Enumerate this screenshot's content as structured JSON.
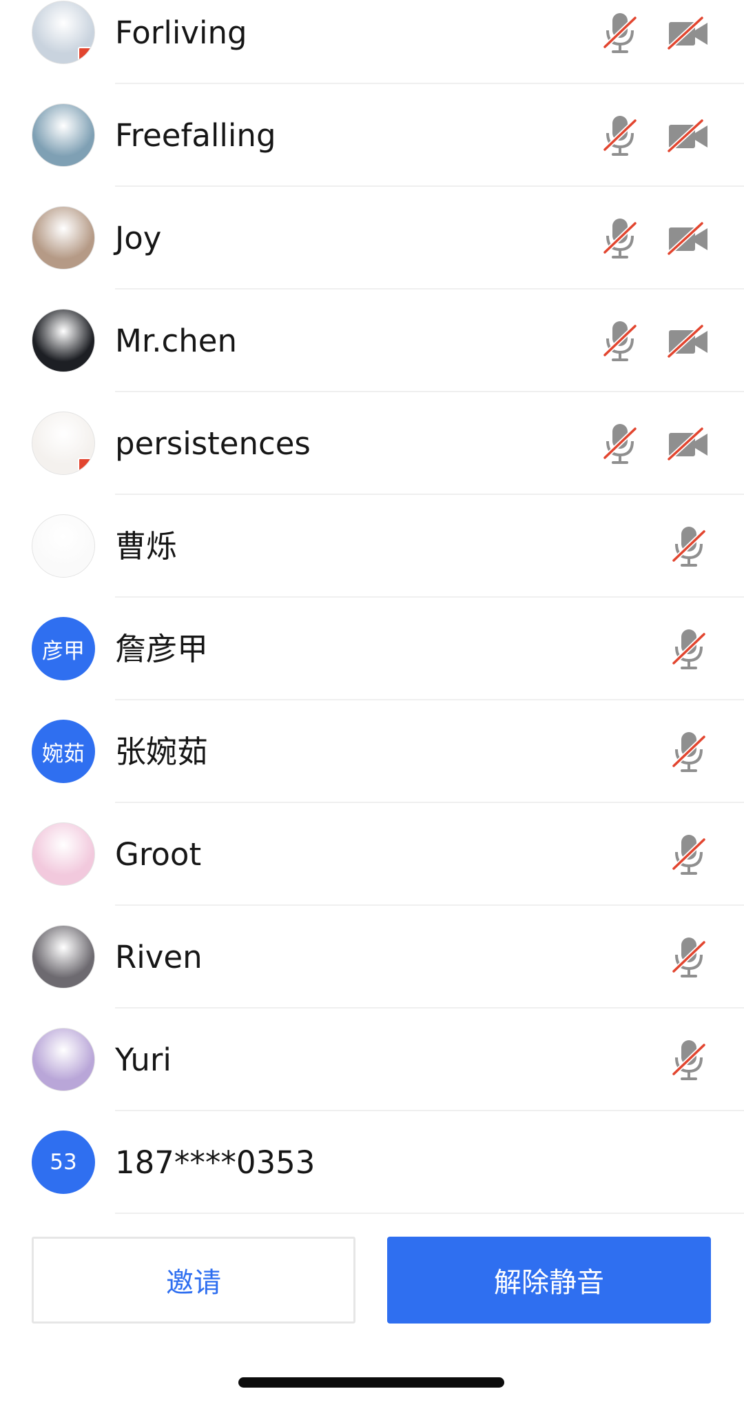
{
  "participants": [
    {
      "name": "Forliving",
      "avatar": "photo",
      "avatar_bg": "#c9d3de",
      "host_flag": true,
      "icons": [
        "mic-muted-icon",
        "camera-off-icon"
      ]
    },
    {
      "name": "Freefalling",
      "avatar": "photo",
      "avatar_bg": "#7fa0b4",
      "host_flag": false,
      "icons": [
        "mic-muted-icon",
        "camera-off-icon"
      ]
    },
    {
      "name": "Joy",
      "avatar": "photo",
      "avatar_bg": "#b59a86",
      "host_flag": false,
      "icons": [
        "mic-muted-icon",
        "camera-off-icon"
      ]
    },
    {
      "name": "Mr.chen",
      "avatar": "photo",
      "avatar_bg": "#1d1f24",
      "host_flag": false,
      "icons": [
        "mic-muted-icon",
        "camera-off-icon"
      ]
    },
    {
      "name": "persistences",
      "avatar": "photo",
      "avatar_bg": "#f4f1ee",
      "host_flag": true,
      "icons": [
        "mic-muted-icon",
        "camera-off-icon"
      ]
    },
    {
      "name": "曹烁",
      "avatar": "photo",
      "avatar_bg": "#fafafa",
      "host_flag": false,
      "icons": [
        "mic-muted-icon"
      ]
    },
    {
      "name": "詹彦甲",
      "avatar": "initials",
      "initials": "彦甲",
      "host_flag": false,
      "icons": [
        "mic-muted-icon"
      ]
    },
    {
      "name": "张婉茹",
      "avatar": "initials",
      "initials": "婉茹",
      "host_flag": false,
      "icons": [
        "mic-muted-icon"
      ]
    },
    {
      "name": "Groot",
      "avatar": "photo",
      "avatar_bg": "#f2c9dd",
      "host_flag": false,
      "icons": [
        "mic-muted-icon"
      ]
    },
    {
      "name": "Riven",
      "avatar": "photo",
      "avatar_bg": "#6d6a70",
      "host_flag": false,
      "icons": [
        "mic-muted-icon"
      ]
    },
    {
      "name": "Yuri",
      "avatar": "photo",
      "avatar_bg": "#b9a6d8",
      "host_flag": false,
      "icons": [
        "mic-muted-icon"
      ]
    },
    {
      "name": "187****0353",
      "avatar": "initials",
      "initials": "53",
      "host_flag": false,
      "icons": []
    }
  ],
  "actions": {
    "invite_label": "邀请",
    "unmute_label": "解除静音"
  },
  "colors": {
    "accent": "#2f6ff0",
    "muted_icon_gray": "#8f8f8f",
    "muted_slash_red": "#e2452f",
    "host_flag_red": "#e2452f"
  }
}
